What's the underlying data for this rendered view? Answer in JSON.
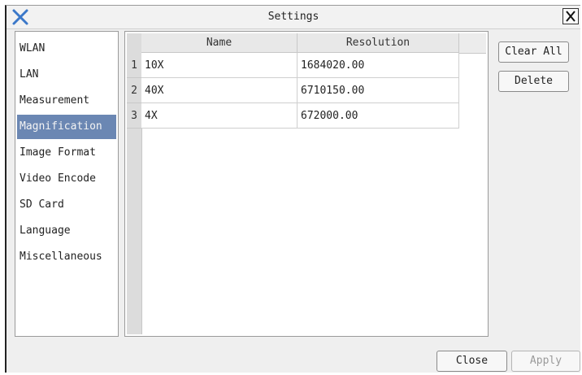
{
  "window": {
    "title": "Settings"
  },
  "nav": {
    "items": [
      {
        "label": "WLAN",
        "selected": false
      },
      {
        "label": "LAN",
        "selected": false
      },
      {
        "label": "Measurement",
        "selected": false
      },
      {
        "label": "Magnification",
        "selected": true
      },
      {
        "label": "Image Format",
        "selected": false
      },
      {
        "label": "Video Encode",
        "selected": false
      },
      {
        "label": "SD Card",
        "selected": false
      },
      {
        "label": "Language",
        "selected": false
      },
      {
        "label": "Miscellaneous",
        "selected": false
      }
    ]
  },
  "table": {
    "columns": [
      "Name",
      "Resolution"
    ],
    "rows": [
      {
        "num": "1",
        "name": "10X",
        "resolution": "1684020.00"
      },
      {
        "num": "2",
        "name": "40X",
        "resolution": "6710150.00"
      },
      {
        "num": "3",
        "name": "4X",
        "resolution": "672000.00"
      }
    ]
  },
  "actions": {
    "clear_all": "Clear All",
    "delete": "Delete"
  },
  "footer": {
    "close": "Close",
    "apply": "Apply"
  },
  "colors": {
    "selection": "#6b87b3",
    "app_icon": "#3b78c9"
  },
  "icons": {
    "app": "x-logo-icon",
    "close": "close-icon"
  }
}
